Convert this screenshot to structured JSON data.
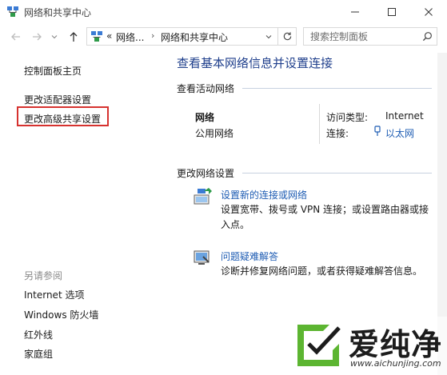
{
  "window": {
    "title": "网络和共享中心",
    "controls": [
      "minimize-icon",
      "maximize-icon",
      "close-icon"
    ]
  },
  "toolbar": {
    "breadcrumb_overflow": "«",
    "breadcrumb": [
      "网络...",
      "网络和共享中心"
    ],
    "search_placeholder": "搜索控制面板"
  },
  "sidebar": {
    "home": "控制面板主页",
    "items": [
      "更改适配器设置",
      "更改高级共享设置"
    ],
    "see_also_heading": "另请参阅",
    "see_also": [
      "Internet 选项",
      "Windows 防火墙",
      "红外线",
      "家庭组"
    ]
  },
  "main": {
    "heading": "查看基本网络信息并设置连接",
    "active_section": "查看活动网络",
    "network": {
      "name": "网络",
      "type": "公用网络",
      "access_label": "访问类型:",
      "access_value": "Internet",
      "connection_label": "连接:",
      "connection_value": "以太网"
    },
    "change_section": "更改网络设置",
    "tasks": [
      {
        "link": "设置新的连接或网络",
        "desc_line1": "设置宽带、拨号或 VPN 连接；或设置路由器或接",
        "desc_line2": "入点。",
        "icon": "new-connection-icon"
      },
      {
        "link": "问题疑难解答",
        "desc_line1": "诊断并修复网络问题，或者获得疑难解答信息。",
        "icon": "troubleshoot-icon"
      }
    ]
  },
  "watermark": {
    "brand": "爱纯净",
    "url": "www.aichunjing.com"
  },
  "colors": {
    "accent": "#1f3f8c",
    "link": "#1e5cb3",
    "highlight": "#d6322f",
    "watermark_green": "#5cb531"
  }
}
